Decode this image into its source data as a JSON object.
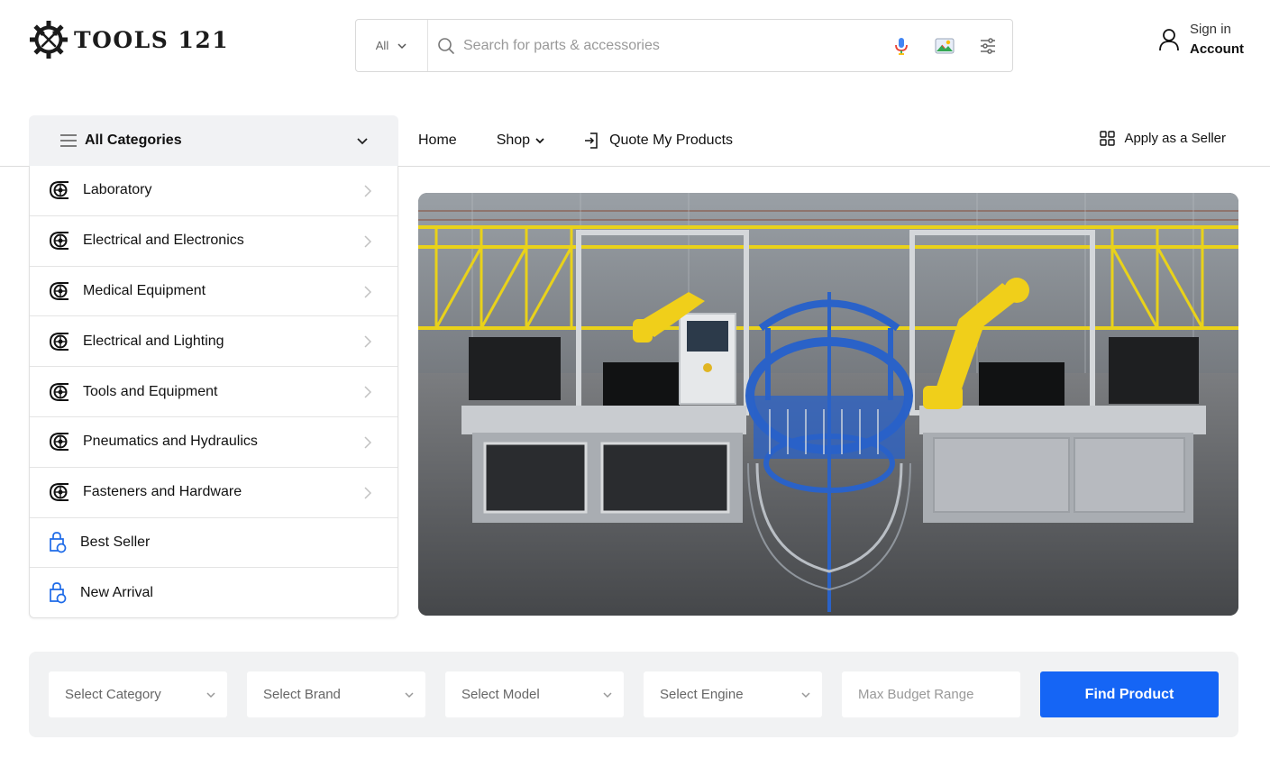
{
  "brand": {
    "name": "TOOLS 121"
  },
  "search": {
    "scope": "All",
    "placeholder": "Search for parts & accessories",
    "icons": [
      "search-icon",
      "microphone-icon",
      "image-search-icon",
      "filter-sliders-icon"
    ]
  },
  "account": {
    "sign_in": "Sign in",
    "label": "Account"
  },
  "nav": {
    "categories_label": "All Categories",
    "home": "Home",
    "shop": "Shop",
    "quote": "Quote My Products",
    "seller": "Apply as a Seller"
  },
  "categories": [
    {
      "label": "Laboratory",
      "icon": "gear-coil-icon"
    },
    {
      "label": "Electrical and Electronics",
      "icon": "gear-coil-icon"
    },
    {
      "label": "Medical Equipment",
      "icon": "gear-coil-icon"
    },
    {
      "label": "Electrical and Lighting",
      "icon": "gear-coil-icon"
    },
    {
      "label": "Tools and Equipment",
      "icon": "gear-coil-icon"
    },
    {
      "label": "Pneumatics and Hydraulics",
      "icon": "gear-coil-icon"
    },
    {
      "label": "Fasteners and Hardware",
      "icon": "gear-coil-icon"
    }
  ],
  "extras": [
    {
      "label": "Best Seller",
      "icon": "shopping-bag-icon"
    },
    {
      "label": "New Arrival",
      "icon": "shopping-bag-icon"
    }
  ],
  "filters": {
    "category": "Select Category",
    "brand": "Select Brand",
    "model": "Select Model",
    "engine": "Select Engine",
    "budget_placeholder": "Max Budget Range",
    "button": "Find Product"
  },
  "colors": {
    "accent": "#1565f5",
    "panel": "#f1f2f4",
    "robot_yellow": "#f0cf1a",
    "conveyor_blue": "#2a62c8"
  }
}
